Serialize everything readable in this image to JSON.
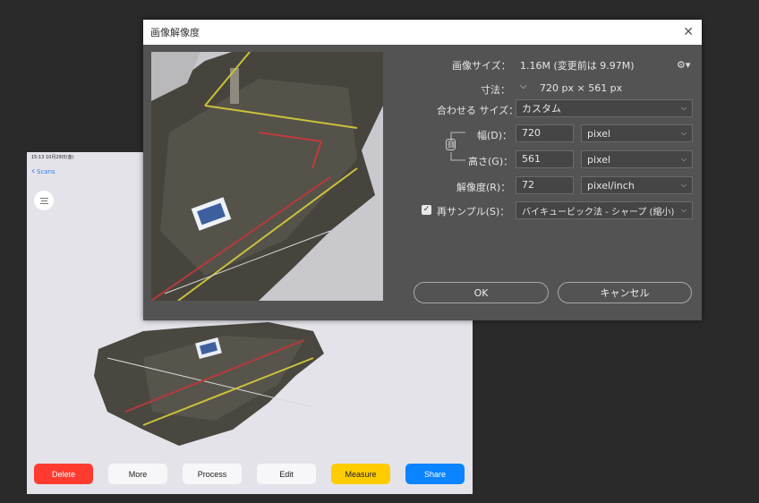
{
  "tablet": {
    "statusbar": "15:13  10月29日(金)",
    "back_label": "Scans",
    "buttons": [
      {
        "label": "Delete",
        "bg": "#ff3b30",
        "fg": "#ffffff"
      },
      {
        "label": "More",
        "bg": "#f7f7f9",
        "fg": "#222222"
      },
      {
        "label": "Process",
        "bg": "#f7f7f9",
        "fg": "#222222"
      },
      {
        "label": "Edit",
        "bg": "#f7f7f9",
        "fg": "#222222"
      },
      {
        "label": "Measure",
        "bg": "#ffcc00",
        "fg": "#222222"
      },
      {
        "label": "Share",
        "bg": "#0a84ff",
        "fg": "#ffffff"
      }
    ]
  },
  "dialog": {
    "title": "画像解像度",
    "image_size_label": "画像サイズ：",
    "image_size_value": "1.16M (変更前は 9.97M)",
    "dimensions_label": "寸法：",
    "dimensions_value": "720 px × 561 px",
    "fit_label": "合わせる サイズ：",
    "fit_value": "カスタム",
    "width_label": "幅(D)：",
    "width_value": "720",
    "width_unit": "pixel",
    "height_label": "高さ(G)：",
    "height_value": "561",
    "height_unit": "pixel",
    "resolution_label": "解像度(R)：",
    "resolution_value": "72",
    "resolution_unit": "pixel/inch",
    "resample_label": "再サンプル(S)：",
    "resample_value": "バイキュービック法 - シャープ (縮小)",
    "ok_label": "OK",
    "cancel_label": "キャンセル"
  }
}
